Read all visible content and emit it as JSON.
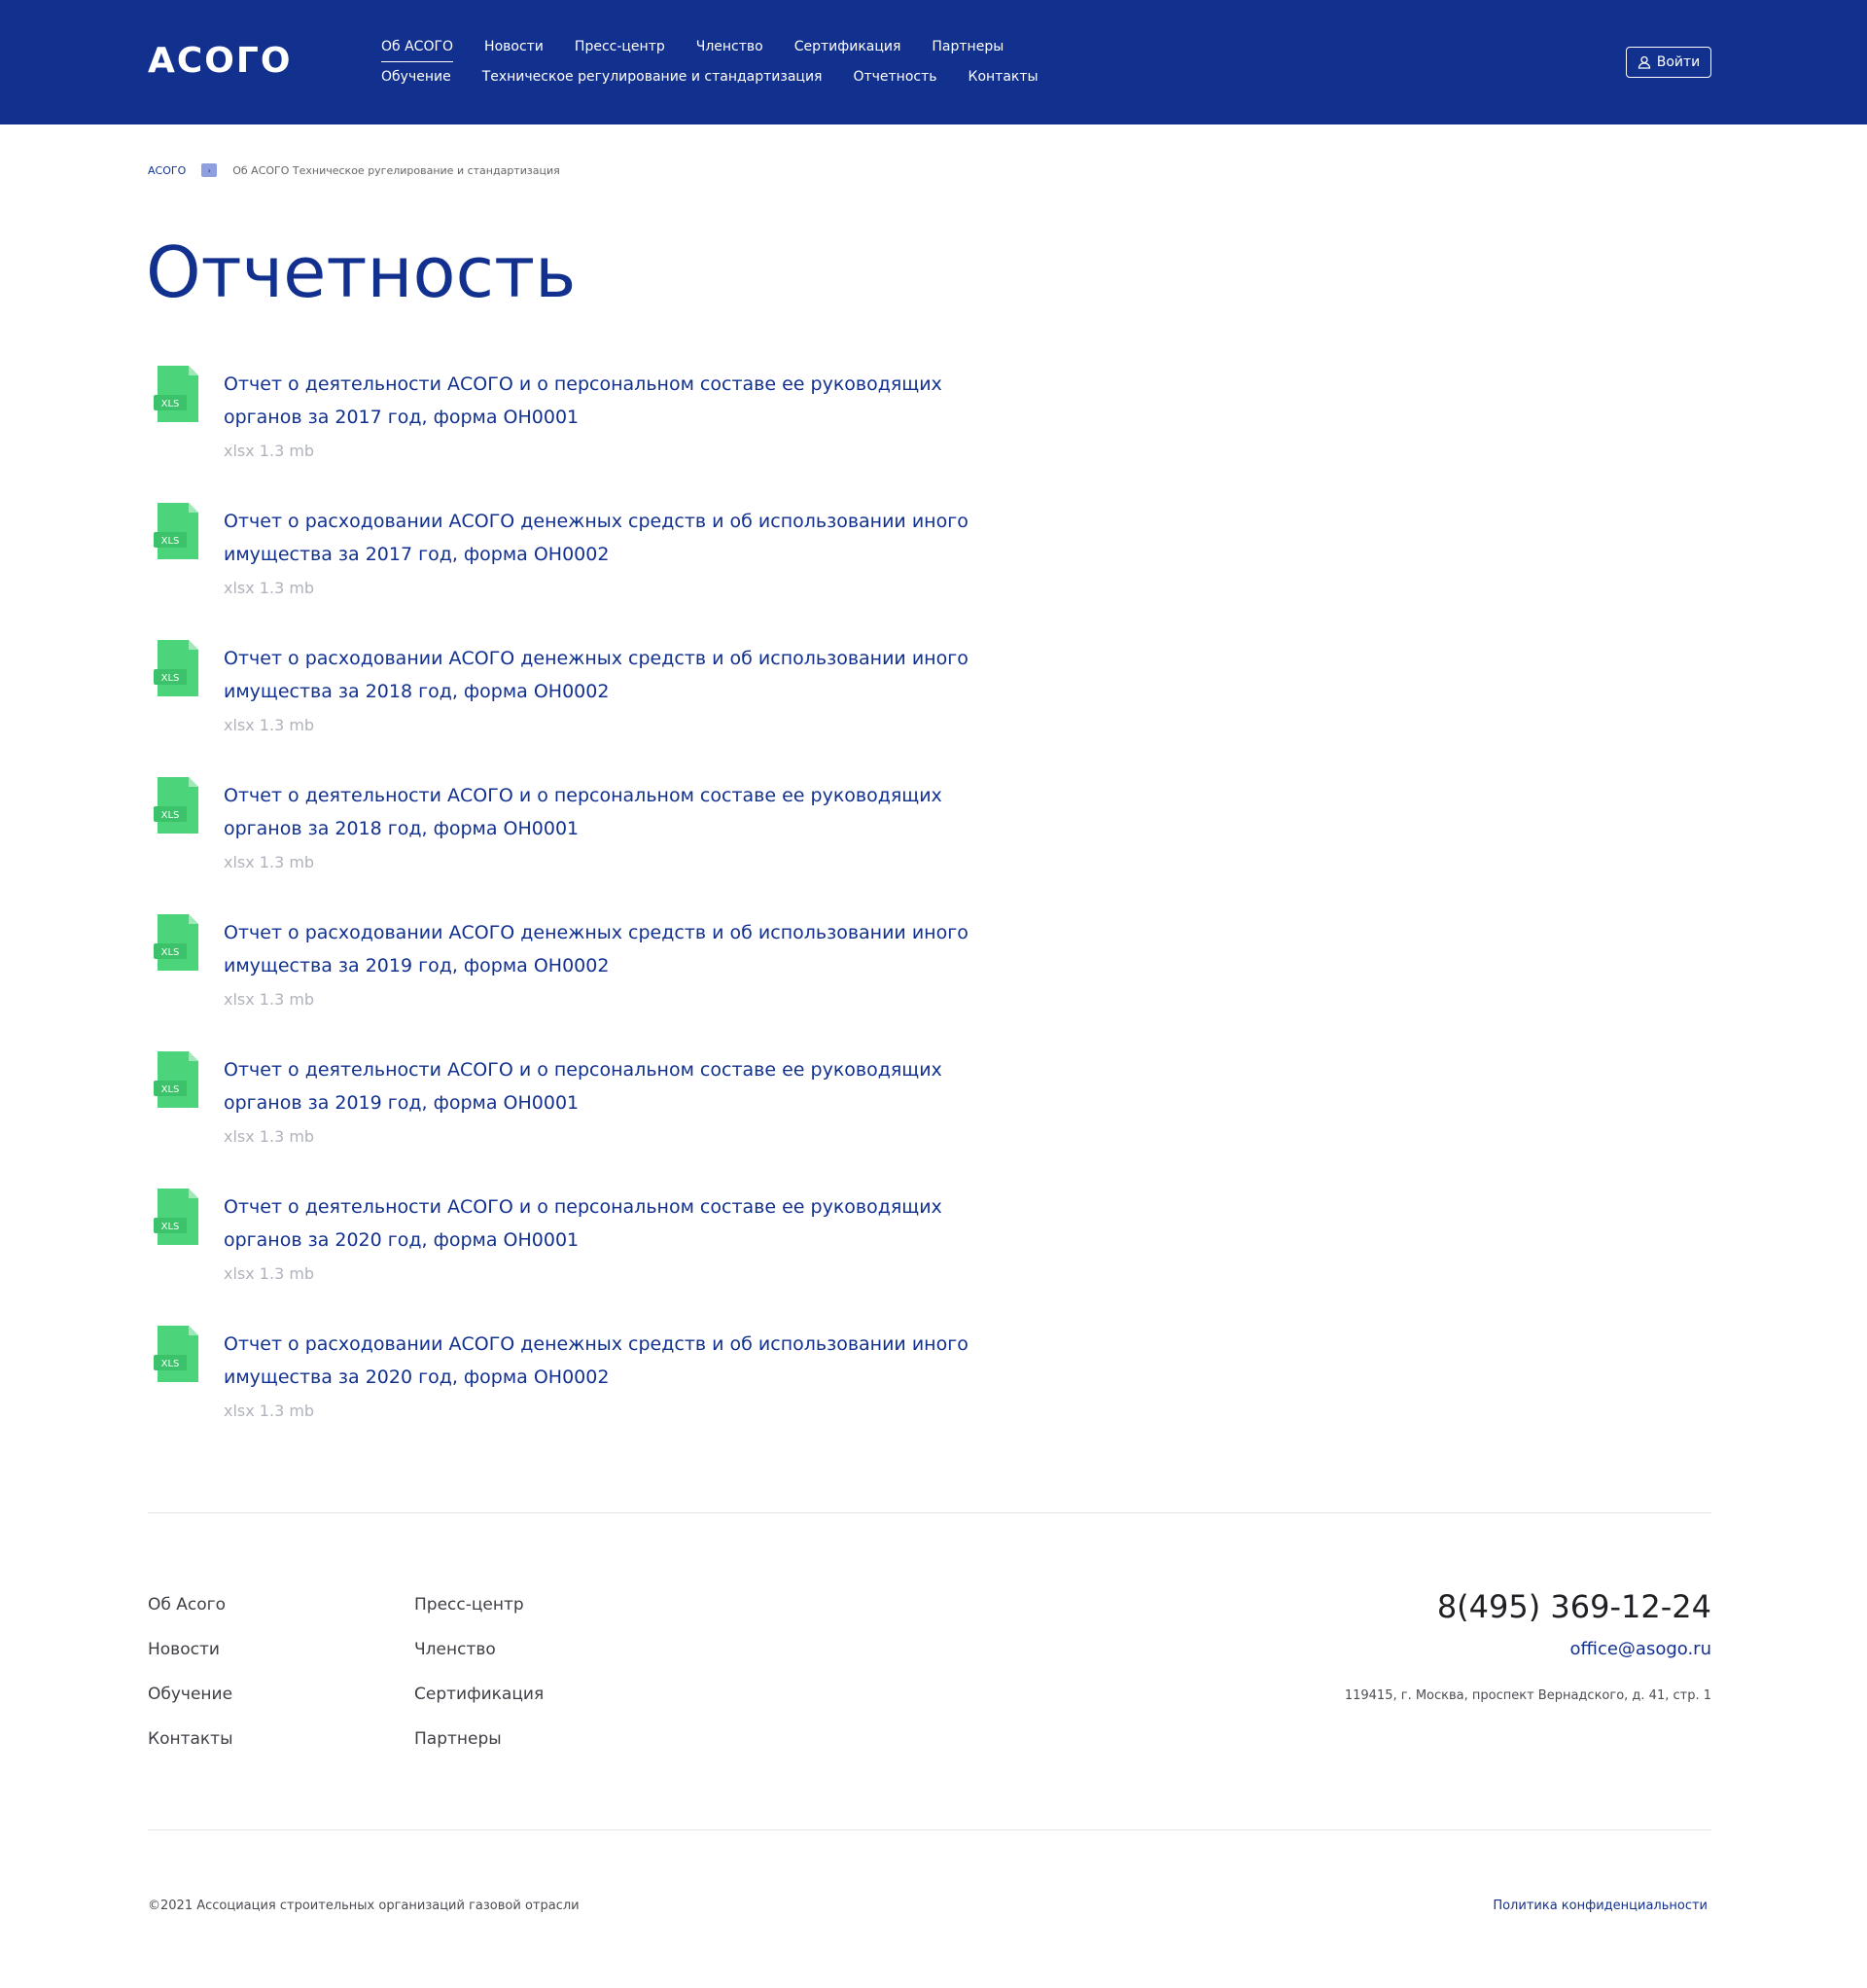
{
  "header": {
    "logo": "АСОГО",
    "nav_row1": [
      "Об АСОГО",
      "Новости",
      "Пресс-центр",
      "Членство",
      "Сертификация",
      "Партнеры"
    ],
    "nav_row2": [
      "Обучение",
      "Техническое регулирование и стандартизация",
      "Отчетность",
      "Контакты"
    ],
    "login": "Войти"
  },
  "breadcrumb": {
    "home": "АСОГО",
    "current": "Об АСОГО Техническое ругелирование и стандартизация"
  },
  "page_title": "Отчетность",
  "documents": [
    {
      "title": "Отчет о деятельности АСОГО и о персональном составе ее руководящих органов за 2017 год, форма ОН0001",
      "meta": "xlsx 1.3 mb",
      "icon_label": "XLS"
    },
    {
      "title": "Отчет о расходовании АСОГО денежных средств и об использовании иного имущества за 2017 год, форма ОН0002",
      "meta": "xlsx 1.3 mb",
      "icon_label": "XLS"
    },
    {
      "title": "Отчет о расходовании АСОГО денежных средств и об использовании иного имущества за 2018 год, форма ОН0002",
      "meta": "xlsx 1.3 mb",
      "icon_label": "XLS"
    },
    {
      "title": "Отчет о деятельности АСОГО и о персональном составе ее руководящих органов за 2018 год, форма ОН0001",
      "meta": "xlsx 1.3 mb",
      "icon_label": "XLS"
    },
    {
      "title": "Отчет о расходовании АСОГО денежных средств и об использовании иного имущества за 2019 год, форма ОН0002",
      "meta": "xlsx 1.3 mb",
      "icon_label": "XLS"
    },
    {
      "title": "Отчет о деятельности АСОГО и о персональном составе ее руководящих органов за 2019 год, форма ОН0001",
      "meta": "xlsx 1.3 mb",
      "icon_label": "XLS"
    },
    {
      "title": "Отчет о деятельности АСОГО и о персональном составе ее руководящих органов за 2020 год, форма ОН0001",
      "meta": "xlsx 1.3 mb",
      "icon_label": "XLS"
    },
    {
      "title": "Отчет о расходовании АСОГО денежных средств и об использовании иного имущества за 2020 год, форма ОН0002",
      "meta": "xlsx 1.3 mb",
      "icon_label": "XLS"
    }
  ],
  "footer": {
    "col1": [
      "Об Асого",
      "Новости",
      "Обучение",
      "Контакты"
    ],
    "col2": [
      "Пресс-центр",
      "Членство",
      "Сертификация",
      "Партнеры"
    ],
    "phone": "8(495) 369-12-24",
    "email": "office@asogo.ru",
    "address": "119415, г. Москва, проспект Вернадского, д. 41, стр. 1",
    "copyright": "©2021 Ассоциация строительных организаций газовой отрасли",
    "policy": "Политика конфиденциальности"
  },
  "colors": {
    "brand": "#12318f",
    "file_icon": "#4cd47a",
    "muted": "#b0b3bc"
  }
}
